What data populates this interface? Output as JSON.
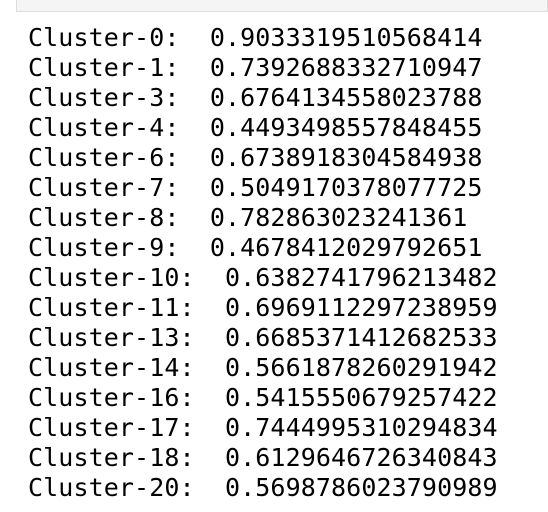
{
  "output": {
    "lines": [
      "Cluster-0:  0.9033319510568414",
      "Cluster-1:  0.7392688332710947",
      "Cluster-3:  0.6764134558023788",
      "Cluster-4:  0.4493498557848455",
      "Cluster-6:  0.6738918304584938",
      "Cluster-7:  0.5049170378077725",
      "Cluster-8:  0.782863023241361",
      "Cluster-9:  0.4678412029792651",
      "Cluster-10:  0.6382741796213482",
      "Cluster-11:  0.6969112297238959",
      "Cluster-13:  0.6685371412682533",
      "Cluster-14:  0.5661878260291942",
      "Cluster-16:  0.5415550679257422",
      "Cluster-17:  0.7444995310294834",
      "Cluster-18:  0.6129646726340843",
      "Cluster-20:  0.5698786023790989"
    ]
  }
}
